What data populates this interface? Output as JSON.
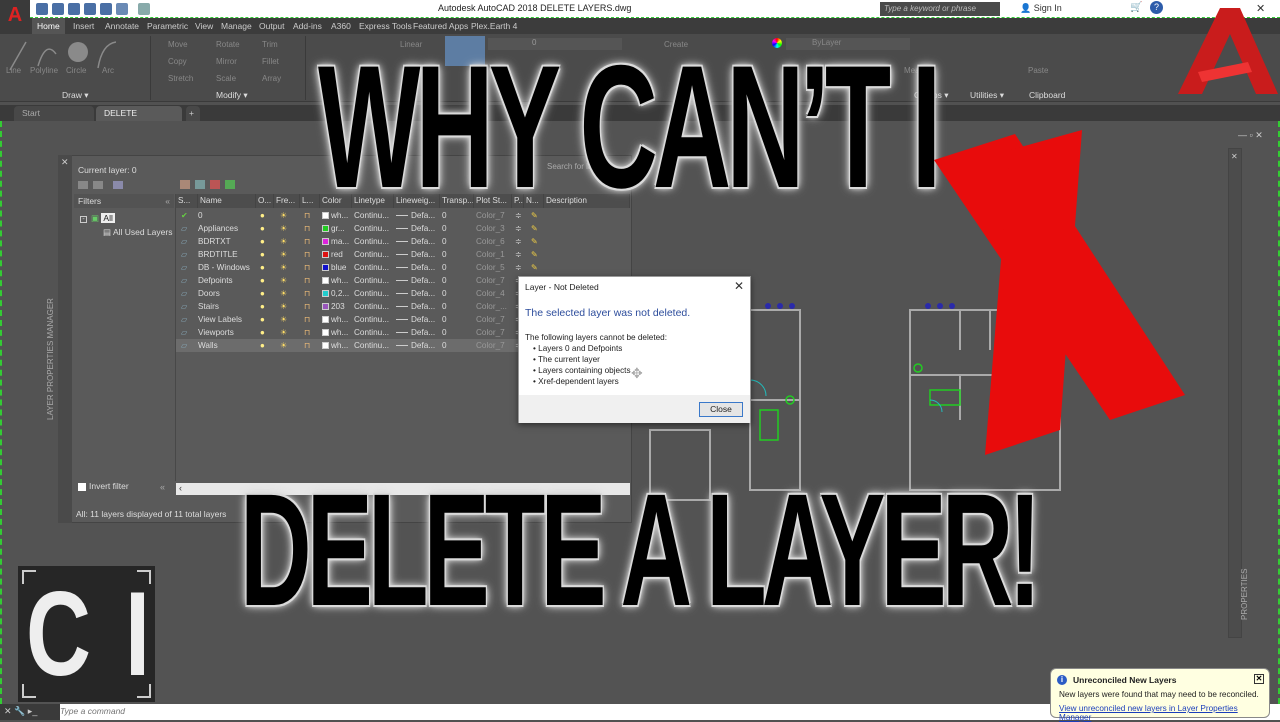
{
  "titlebar": {
    "app_button": "A",
    "title": "Autodesk AutoCAD 2018    DELETE LAYERS.dwg",
    "search_placeholder": "Type a keyword or phrase",
    "sign_in": "Sign In",
    "minimize": "—",
    "maximize": "☐",
    "close": "✕"
  },
  "ribbon": {
    "tabs": [
      "Home",
      "Insert",
      "Annotate",
      "Parametric",
      "View",
      "Manage",
      "Output",
      "Add-ins",
      "A360",
      "Express Tools",
      "Featured Apps",
      "Plex.Earth 4"
    ],
    "active_tab": "Home",
    "draw_tools": [
      "Line",
      "Polyline",
      "Circle",
      "Arc"
    ],
    "modify_tools": [
      "Move",
      "Rotate",
      "Trim",
      "Copy",
      "Mirror",
      "Fillet",
      "Stretch",
      "Scale",
      "Array"
    ],
    "annotation_tools": [
      "Linear"
    ],
    "layer_dropdown": "0",
    "block_tools": [
      "Create"
    ],
    "properties_dropdown": "ByLayer",
    "utilities_tools": [
      "Measure"
    ],
    "clipboard_tools": [
      "Paste"
    ],
    "groups": [
      "Draw",
      "Modify",
      "Groups",
      "Utilities",
      "Clipboard"
    ]
  },
  "doc_tabs": {
    "start": "Start",
    "active": "DELETE LAYERS*",
    "add": "+"
  },
  "layer_palette": {
    "side_label": "LAYER PROPERTIES MANAGER",
    "current_layer": "Current layer: 0",
    "search_placeholder": "Search for layer",
    "filters_header": "Filters",
    "filter_all": "All",
    "filter_used": "All Used Layers",
    "invert_filter": "Invert filter",
    "status": "All: 11 layers displayed of 11 total layers",
    "columns": [
      "S...",
      "Name",
      "O...",
      "Fre...",
      "L...",
      "Color",
      "Linetype",
      "Lineweig...",
      "Transp...",
      "Plot St...",
      "P...",
      "N...",
      "Description"
    ],
    "rows": [
      {
        "status": "current",
        "name": "0",
        "color": "wh...",
        "swatch": "#ffffff",
        "linetype": "Continu...",
        "lineweight": "Defa...",
        "transparency": "0",
        "plot_style": "Color_7"
      },
      {
        "status": "layer",
        "name": "Appliances",
        "color": "gr...",
        "swatch": "#22cc22",
        "linetype": "Continu...",
        "lineweight": "Defa...",
        "transparency": "0",
        "plot_style": "Color_3"
      },
      {
        "status": "layer",
        "name": "BDRTXT",
        "color": "ma...",
        "swatch": "#dd22dd",
        "linetype": "Continu...",
        "lineweight": "Defa...",
        "transparency": "0",
        "plot_style": "Color_6"
      },
      {
        "status": "layer",
        "name": "BRDTITLE",
        "color": "red",
        "swatch": "#dd1111",
        "linetype": "Continu...",
        "lineweight": "Defa...",
        "transparency": "0",
        "plot_style": "Color_1"
      },
      {
        "status": "layer",
        "name": "DB - Windows",
        "color": "blue",
        "swatch": "#1111cc",
        "linetype": "Continu...",
        "lineweight": "Defa...",
        "transparency": "0",
        "plot_style": "Color_5"
      },
      {
        "status": "layer",
        "name": "Defpoints",
        "color": "wh...",
        "swatch": "#ffffff",
        "linetype": "Continu...",
        "lineweight": "Defa...",
        "transparency": "0",
        "plot_style": "Color_7"
      },
      {
        "status": "layer",
        "name": "Doors",
        "color": "0,2...",
        "swatch": "#22cccc",
        "linetype": "Continu...",
        "lineweight": "Defa...",
        "transparency": "0",
        "plot_style": "Color_4"
      },
      {
        "status": "layer",
        "name": "Stairs",
        "color": "203",
        "swatch": "#9955bb",
        "linetype": "Continu...",
        "lineweight": "Defa...",
        "transparency": "0",
        "plot_style": "Color_..."
      },
      {
        "status": "layer",
        "name": "View Labels",
        "color": "wh...",
        "swatch": "#ffffff",
        "linetype": "Continu...",
        "lineweight": "Defa...",
        "transparency": "0",
        "plot_style": "Color_7"
      },
      {
        "status": "layer",
        "name": "Viewports",
        "color": "wh...",
        "swatch": "#ffffff",
        "linetype": "Continu...",
        "lineweight": "Defa...",
        "transparency": "0",
        "plot_style": "Color_7"
      },
      {
        "status": "layer",
        "name": "Walls",
        "color": "wh...",
        "swatch": "#ffffff",
        "linetype": "Continu...",
        "lineweight": "Defa...",
        "transparency": "0",
        "plot_style": "Color_7",
        "selected": true
      }
    ]
  },
  "dialog": {
    "title": "Layer - Not Deleted",
    "main": "The selected layer was not deleted.",
    "intro": "The following layers cannot be deleted:",
    "bullets": [
      "Layers 0 and Defpoints",
      "The current layer",
      "Layers containing objects",
      "Xref-dependent layers"
    ],
    "close_button": "Close"
  },
  "overlay": {
    "headline_top": "WHY CAN’T I",
    "headline_bottom": "DELETE A LAYER!",
    "badge": "C I",
    "accent_red": "#e80c0c"
  },
  "properties_palette": {
    "label": "PROPERTIES"
  },
  "command_line": {
    "placeholder": "Type a command"
  },
  "notification": {
    "title": "Unreconciled New Layers",
    "body": "New layers were found that may need to be reconciled.",
    "link": "View unreconciled new layers in Layer Properties Manager"
  }
}
